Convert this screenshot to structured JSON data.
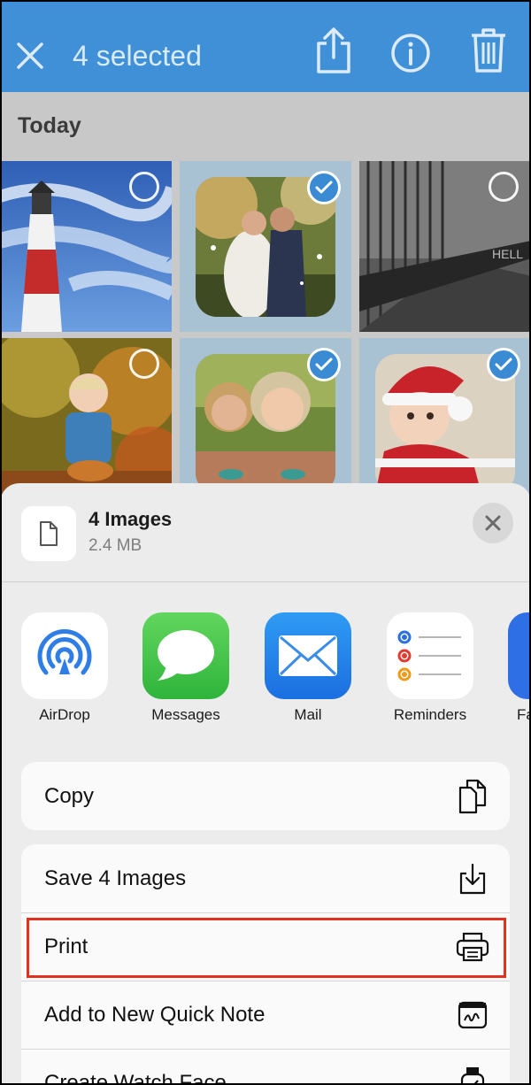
{
  "navbar": {
    "title": "4 selected",
    "close_icon": "close-icon",
    "share_icon": "share-icon",
    "info_icon": "info-icon",
    "trash_icon": "trash-icon",
    "color": "#3f90d6"
  },
  "photos": {
    "section_label": "Today",
    "items": [
      {
        "subject": "lighthouse",
        "selected": false
      },
      {
        "subject": "wedding couple",
        "selected": true
      },
      {
        "subject": "corridor",
        "selected": false
      },
      {
        "subject": "child in leaves",
        "selected": false
      },
      {
        "subject": "laughing women",
        "selected": true
      },
      {
        "subject": "baby in santa hat",
        "selected": true
      }
    ]
  },
  "share_sheet": {
    "file_title": "4 Images",
    "file_size": "2.4 MB",
    "apps": [
      {
        "label": "AirDrop",
        "icon": "airdrop-icon"
      },
      {
        "label": "Messages",
        "icon": "messages-icon"
      },
      {
        "label": "Mail",
        "icon": "mail-icon"
      },
      {
        "label": "Reminders",
        "icon": "reminders-icon"
      },
      {
        "label": "Fa",
        "icon": "app-icon"
      }
    ],
    "actions_group1": [
      {
        "label": "Copy",
        "icon": "copy-icon"
      }
    ],
    "actions_group2": [
      {
        "label": "Save 4 Images",
        "icon": "save-icon"
      },
      {
        "label": "Print",
        "icon": "printer-icon",
        "highlighted": true
      },
      {
        "label": "Add to New Quick Note",
        "icon": "quick-note-icon"
      },
      {
        "label": "Create Watch Face",
        "icon": "watch-icon"
      }
    ],
    "highlight_color": "#e2311c"
  }
}
